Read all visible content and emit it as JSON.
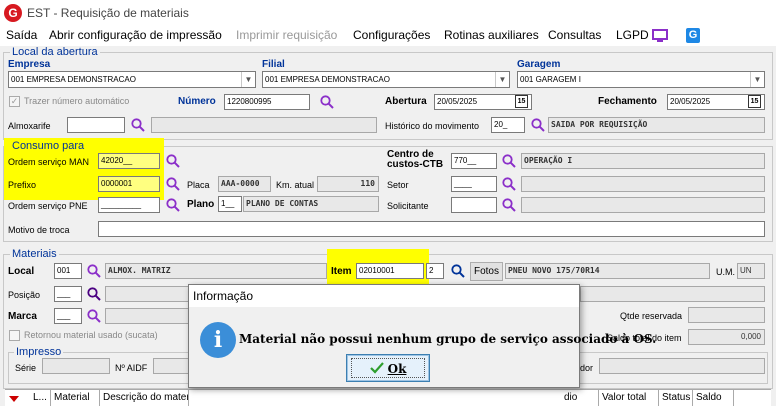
{
  "window": {
    "logo": "G",
    "title": "EST - Requisição de materiais"
  },
  "menu": {
    "items": [
      "Saída",
      "Abrir configuração de impressão",
      "Imprimir requisição",
      "Configurações",
      "Rotinas auxiliares",
      "Consultas",
      "LGPD"
    ]
  },
  "abertura": {
    "legend": "Local da abertura",
    "empresa_label": "Empresa",
    "empresa_value": "001 EMPRESA DEMONSTRACAO",
    "filial_label": "Filial",
    "filial_value": "001 EMPRESA DEMONSTRACAO",
    "garagem_label": "Garagem",
    "garagem_value": "001 GARAGEM I",
    "trazer_numero_label": "Trazer número automático",
    "numero_label": "Número",
    "numero_value": "1220800995",
    "abertura_label": "Abertura",
    "abertura_value": "20/05/2025",
    "fechamento_label": "Fechamento",
    "fechamento_value": "20/05/2025",
    "calendar_glyph": "15",
    "almoxarife_label": "Almoxarife",
    "almoxarife_value": "",
    "historico_label": "Histórico do movimento",
    "historico_code": "20_",
    "historico_desc": "SAIDA POR REQUISIÇÃO"
  },
  "consumo": {
    "legend": "Consumo para",
    "os_man_label": "Ordem serviço MAN",
    "os_man_value": "42020__",
    "prefixo_label": "Prefixo",
    "prefixo_value": "0000001",
    "os_pne_label": "Ordem serviço PNE",
    "os_pne_value": "_________",
    "placa_label": "Placa",
    "placa_value": "AAA-0000",
    "km_label": "Km. atual",
    "km_value": "110",
    "plano_label": "Plano",
    "plano_code": "1__",
    "plano_desc": "PLANO DE CONTAS",
    "centro_label": "Centro de custos-CTB",
    "centro_code": "770__",
    "centro_desc": "OPERAÇÃO I",
    "setor_label": "Setor",
    "setor_value": "____",
    "solicitante_label": "Solicitante",
    "solicitante_value": "",
    "motivo_label": "Motivo de troca",
    "motivo_value": ""
  },
  "materiais": {
    "legend": "Materiais",
    "local_label": "Local",
    "local_code": "001",
    "local_desc": "ALMOX. MATRIZ",
    "item_label": "Item",
    "item_value": "02010001",
    "item_digit": "2",
    "fotos_label": "Fotos",
    "item_desc": "PNEU NOVO 175/70R14",
    "um_label": "U.M.",
    "um_value": "UN",
    "posicao_label": "Posição",
    "posicao_value": "___",
    "marca_label": "Marca",
    "marca_value": "___",
    "qtde_label": "Qtde reservada",
    "retornou_label": "Retornou material usado (sucata)",
    "saldo_label": "Saldo total do item",
    "saldo_value": "0,000"
  },
  "impresso": {
    "legend": "Impresso",
    "serie_label": "Série",
    "aidf_label": "Nº AIDF",
    "dor_label": "dor"
  },
  "table": {
    "columns": [
      "L...",
      "Material",
      "Descrição do mater",
      "dio",
      "Valor total",
      "Status",
      "Saldo"
    ]
  },
  "dialog": {
    "title": "Informação",
    "icon": "i",
    "message": "Material não possui nenhum grupo de serviço associado à OS.",
    "ok_label": "Ok"
  },
  "colors": {
    "highlight": "#ffff00",
    "accent": "#003399",
    "search_icon": "#8b2fc9"
  }
}
